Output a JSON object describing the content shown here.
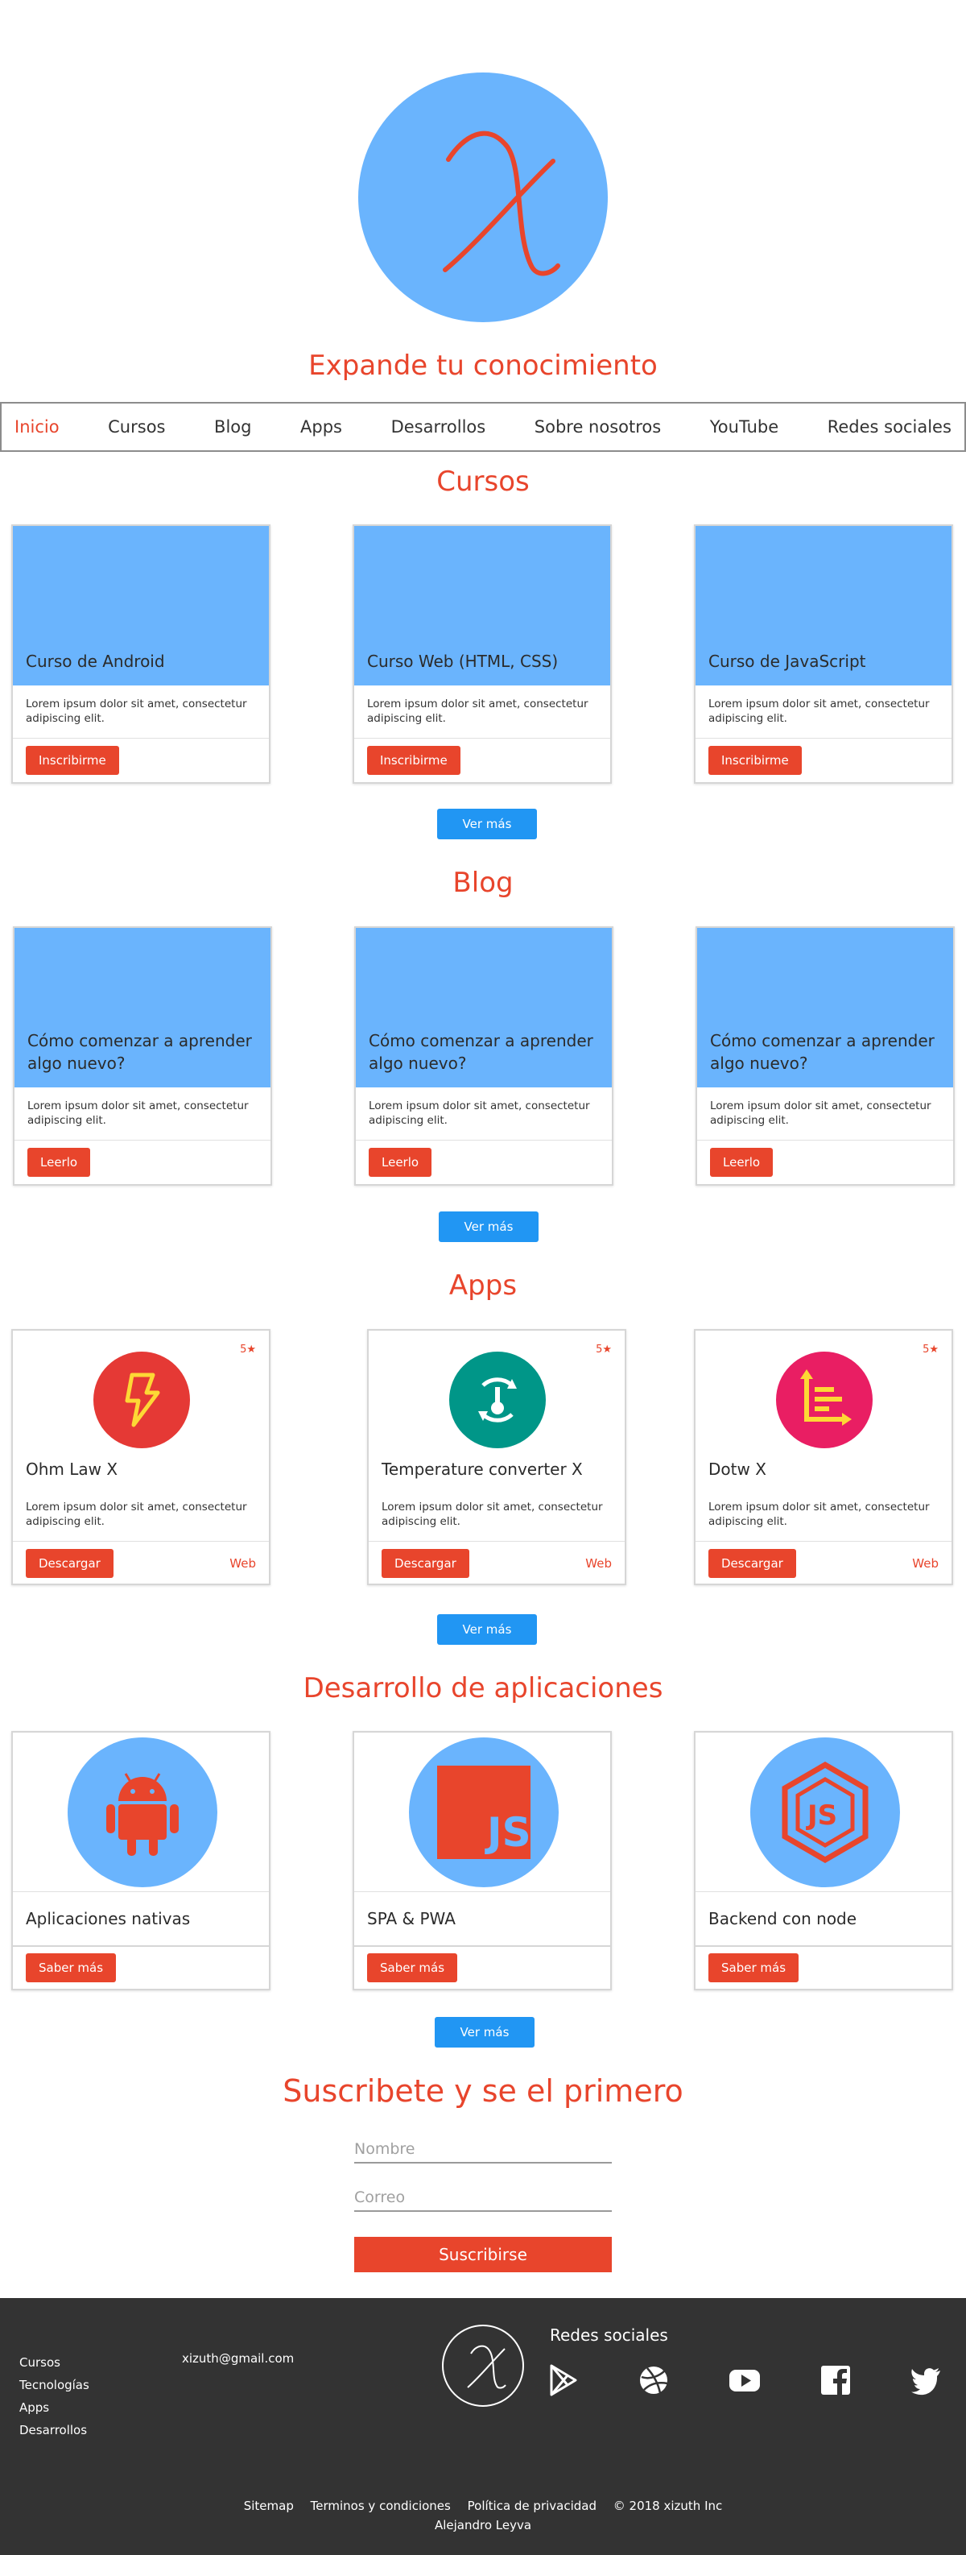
{
  "hero": {
    "tagline": "Expande tu conocimiento",
    "logo_icon": "x-script-logo-icon"
  },
  "nav": {
    "items": [
      "Inicio",
      "Cursos",
      "Blog",
      "Apps",
      "Desarrollos",
      "Sobre nosotros",
      "YouTube",
      "Redes sociales"
    ],
    "active": "Inicio"
  },
  "courses": {
    "title": "Cursos",
    "cards": [
      {
        "title": "Curso de Android",
        "text": "Lorem ipsum dolor sit amet, consectetur adipiscing elit.",
        "button": "Inscribirme"
      },
      {
        "title": "Curso Web (HTML, CSS)",
        "text": "Lorem ipsum dolor sit amet, consectetur adipiscing elit.",
        "button": "Inscribirme"
      },
      {
        "title": "Curso de JavaScript",
        "text": "Lorem ipsum dolor sit amet, consectetur adipiscing elit.",
        "button": "Inscribirme"
      }
    ],
    "more": "Ver más"
  },
  "blog": {
    "title": "Blog",
    "cards": [
      {
        "title": "Cómo comenzar a aprender algo nuevo?",
        "text": "Lorem ipsum dolor sit amet, consectetur adipiscing elit.",
        "button": "Leerlo"
      },
      {
        "title": "Cómo comenzar a aprender algo nuevo?",
        "text": "Lorem ipsum dolor sit amet, consectetur adipiscing elit.",
        "button": "Leerlo"
      },
      {
        "title": "Cómo comenzar a aprender algo nuevo?",
        "text": "Lorem ipsum dolor sit amet, consectetur adipiscing elit.",
        "button": "Leerlo"
      }
    ],
    "more": "Ver más"
  },
  "apps": {
    "title": "Apps",
    "cards": [
      {
        "name": "Ohm Law X",
        "rating": "5★",
        "text": "Lorem ipsum dolor sit amet, consectetur adipiscing elit.",
        "download": "Descargar",
        "web": "Web",
        "icon": "lightning-icon",
        "color": "#e53935"
      },
      {
        "name": "Temperature converter X",
        "rating": "5★",
        "text": "Lorem ipsum dolor sit amet, consectetur adipiscing elit.",
        "download": "Descargar",
        "web": "Web",
        "icon": "thermometer-icon",
        "color": "#009688"
      },
      {
        "name": "Dotw X",
        "rating": "5★",
        "text": "Lorem ipsum dolor sit amet, consectetur adipiscing elit.",
        "download": "Descargar",
        "web": "Web",
        "icon": "timeline-chart-icon",
        "color": "#e91e63"
      }
    ],
    "more": "Ver más"
  },
  "dev": {
    "title": "Desarrollo de aplicaciones",
    "cards": [
      {
        "name": "Aplicaciones nativas",
        "button": "Saber más",
        "icon": "android-icon"
      },
      {
        "name": "SPA & PWA",
        "button": "Saber más",
        "icon": "javascript-icon"
      },
      {
        "name": "Backend con node",
        "button": "Saber más",
        "icon": "nodejs-icon"
      }
    ],
    "more": "Ver más"
  },
  "subscribe": {
    "title": "Suscribete y se el primero",
    "name_placeholder": "Nombre",
    "email_placeholder": "Correo",
    "button": "Suscribirse"
  },
  "footer": {
    "links": [
      "Cursos",
      "Tecnologías",
      "Apps",
      "Desarrollos"
    ],
    "email": "xizuth@gmail.com",
    "social_title": "Redes sociales",
    "social_icons": [
      "google-play-icon",
      "dribbble-icon",
      "youtube-icon",
      "facebook-icon",
      "twitter-icon"
    ],
    "bottom_links": [
      "Sitemap",
      "Terminos y condiciones",
      "Política de privacidad",
      "© 2018 xizuth Inc"
    ],
    "author": "Alejandro Leyva"
  },
  "colors": {
    "accent": "#e8452c",
    "primary_blue": "#6ab4fd",
    "button_blue": "#2196f3",
    "footer_bg": "#333333"
  }
}
